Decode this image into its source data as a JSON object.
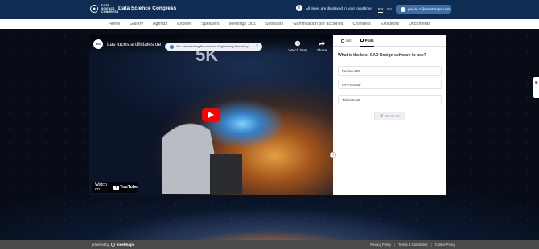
{
  "header": {
    "brand_small": [
      "DATA",
      "SCIENCE",
      "CONGRESS"
    ],
    "brand_title": "Data Science Congress",
    "timezone_note": "All times are displayed in your local time",
    "lang_en": "EN",
    "lang_es": "ES",
    "user_email": "paula+1@meetmaps.com"
  },
  "nav": {
    "items": [
      "Home",
      "Gallery",
      "Agenda",
      "Explore",
      "Speakers",
      "Meetings 1to1",
      "Sponsors",
      "Gamificación por acciones",
      "Channels",
      "Exhibitors",
      "Documents"
    ]
  },
  "video": {
    "channel_avatar": "DSC",
    "title": "Las luces artificiales de",
    "overlay_text": "5K",
    "watch_later": "Watch later",
    "share": "Share",
    "watch_on": "Watch on",
    "youtube": "YouTube"
  },
  "session_banner": {
    "text": "You are watching the session: Engineering Workshop",
    "close": "×"
  },
  "panel": {
    "tabs": [
      "Info",
      "Polls"
    ],
    "active_tab": "Polls",
    "question": "What is the best CAD Design software to use?",
    "options": [
      "Fusion 360",
      "OPENScad",
      "TinkerCAD"
    ],
    "send_label": "Send vote"
  },
  "footer": {
    "powered_by": "powered by",
    "powered_brand": "meetmaps",
    "links": [
      "Privacy Policy",
      "Terms & Conditions",
      "Cookie Policy"
    ]
  },
  "colors": {
    "header_bg": "#0f2d52",
    "accent": "#3b6ea5",
    "youtube_red": "#ff0000",
    "footer_bg": "#4a4a4a"
  },
  "icons": {
    "timezone": "info-circle-icon",
    "user": "user-icon",
    "watch_later": "clock-icon",
    "share": "share-arrow-icon",
    "play": "play-icon",
    "send": "paper-plane-icon"
  }
}
